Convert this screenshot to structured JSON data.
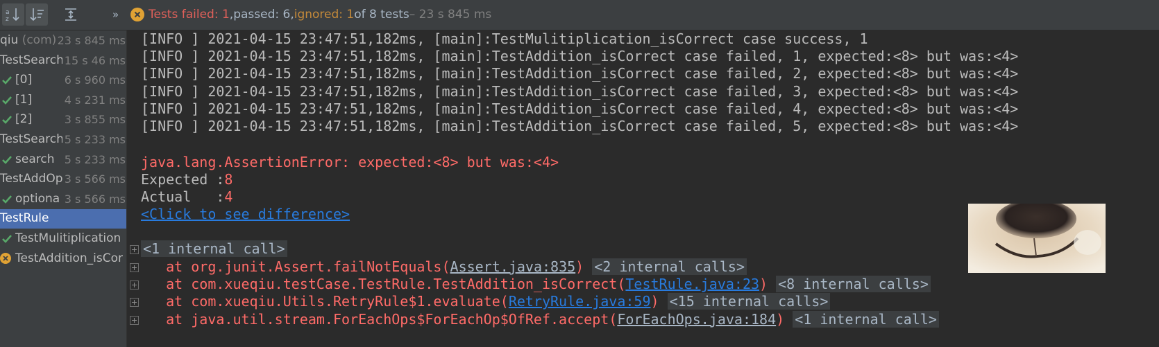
{
  "toolbar": {
    "buttons": [
      {
        "name": "sort-alpha-icon",
        "active": true
      },
      {
        "name": "sort-duration-icon",
        "active": true
      },
      {
        "name": "expand-all-icon",
        "active": false
      }
    ],
    "more": "»"
  },
  "status": {
    "failed": "Tests failed: 1",
    "sep1": ", ",
    "passed": "passed: 6",
    "sep2": ", ",
    "ignored": "ignored: 1",
    "total": " of 8 tests",
    "time": " – 23 s 845 ms"
  },
  "tree": [
    {
      "label": "qiu",
      "suffix": " (com)",
      "time": "23 s 845 ms",
      "icon": "none"
    },
    {
      "label": "TestSearch",
      "suffix": "",
      "time": "15 s 46 ms",
      "icon": "none"
    },
    {
      "label": "[0]",
      "suffix": "",
      "time": "6 s 960 ms",
      "icon": "check-icon"
    },
    {
      "label": "[1]",
      "suffix": "",
      "time": "4 s 231 ms",
      "icon": "check-icon"
    },
    {
      "label": "[2]",
      "suffix": "",
      "time": "3 s 855 ms",
      "icon": "check-icon"
    },
    {
      "label": "TestSearch",
      "suffix": "",
      "time": "5 s 233 ms",
      "icon": "none"
    },
    {
      "label": "search",
      "suffix": "",
      "time": "5 s 233 ms",
      "icon": "check-icon"
    },
    {
      "label": "TestAddOp",
      "suffix": "",
      "time": "3 s 566 ms",
      "icon": "none"
    },
    {
      "label": "optiona",
      "suffix": "",
      "time": "3 s 566 ms",
      "icon": "check-icon"
    },
    {
      "label": "TestRule",
      "suffix": "",
      "time": "",
      "icon": "none"
    },
    {
      "label": "TestMulitiplication",
      "suffix": "",
      "time": "",
      "icon": "check-icon"
    },
    {
      "label": "TestAddition_isCor",
      "suffix": "",
      "time": "",
      "icon": "fail-icon"
    }
  ],
  "console": {
    "log_lines": [
      "[INFO ] 2021-04-15 23:47:51,182ms, [main]:TestMulitiplication_isCorrect case success, 1",
      "[INFO ] 2021-04-15 23:47:51,182ms, [main]:TestAddition_isCorrect case failed, 1, expected:<8> but was:<4>",
      "[INFO ] 2021-04-15 23:47:51,182ms, [main]:TestAddition_isCorrect case failed, 2, expected:<8> but was:<4>",
      "[INFO ] 2021-04-15 23:47:51,182ms, [main]:TestAddition_isCorrect case failed, 3, expected:<8> but was:<4>",
      "[INFO ] 2021-04-15 23:47:51,182ms, [main]:TestAddition_isCorrect case failed, 4, expected:<8> but was:<4>",
      "[INFO ] 2021-04-15 23:47:51,182ms, [main]:TestAddition_isCorrect case failed, 5, expected:<8> but was:<4>"
    ],
    "error": "java.lang.AssertionError: expected:<8> but was:<4>",
    "expected_label": "Expected :",
    "expected_value": "8",
    "actual_label": "Actual   :",
    "actual_value": "4",
    "diff_link": "<Click to see difference>",
    "internal_call": "<1 internal call>",
    "stack": [
      {
        "pre": "   at org.junit.Assert.failNotEquals(",
        "link": "Assert.java:835",
        "link_style": "plain",
        "post": ")",
        "collapsed": "<2 internal calls>"
      },
      {
        "pre": "   at com.xueqiu.testCase.TestRule.TestAddition_isCorrect(",
        "link": "TestRule.java:23",
        "link_style": "blue",
        "post": ")",
        "collapsed": "<8 internal calls>"
      },
      {
        "pre": "   at com.xueqiu.Utils.RetryRule$1.evaluate(",
        "link": "RetryRule.java:59",
        "link_style": "blue",
        "post": ")",
        "collapsed": "<15 internal calls>"
      },
      {
        "pre": "   at java.util.stream.ForEachOps$ForEachOp$OfRef.accept(",
        "link": "ForEachOps.java:184",
        "link_style": "plain",
        "post": ")",
        "collapsed": "<1 internal call>"
      }
    ]
  },
  "colors": {
    "error": "#ff6b68",
    "link": "#287bde",
    "check": "#59a869",
    "fail": "#e0a234",
    "selected": "#4b6eaf"
  }
}
